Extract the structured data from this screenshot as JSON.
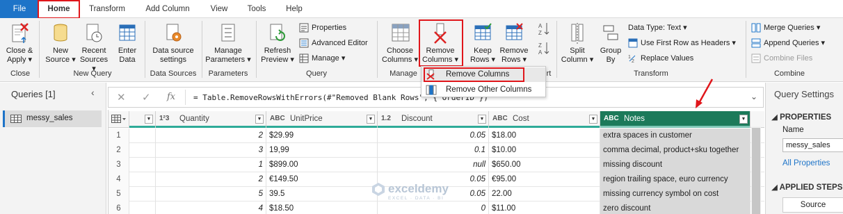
{
  "tabs": [
    "File",
    "Home",
    "Transform",
    "Add Column",
    "View",
    "Tools",
    "Help"
  ],
  "ribbon": {
    "close_apply": "Close &",
    "close_apply2": "Apply",
    "new_source": "New",
    "new_source2": "Source",
    "recent_sources": "Recent",
    "recent_sources2": "Sources",
    "enter_data": "Enter",
    "enter_data2": "Data",
    "data_source_settings": "Data source",
    "data_source_settings2": "settings",
    "manage_parameters": "Manage",
    "manage_parameters2": "Parameters",
    "refresh_preview": "Refresh",
    "refresh_preview2": "Preview",
    "properties": "Properties",
    "advanced_editor": "Advanced Editor",
    "manage": "Manage",
    "choose_columns": "Choose",
    "choose_columns2": "Columns",
    "remove_columns": "Remove",
    "remove_columns2": "Columns",
    "keep_rows": "Keep",
    "keep_rows2": "Rows",
    "remove_rows": "Remove",
    "remove_rows2": "Rows",
    "split_column": "Split",
    "split_column2": "Column",
    "group_by": "Group",
    "group_by2": "By",
    "data_type": "Data Type: Text",
    "use_first_row": "Use First Row as Headers",
    "replace_values": "Replace Values",
    "merge_queries": "Merge Queries",
    "append_queries": "Append Queries",
    "combine_files": "Combine Files",
    "groups": {
      "close": "Close",
      "new_query": "New Query",
      "data_sources": "Data Sources",
      "parameters": "Parameters",
      "query": "Query",
      "manage": "Manage",
      "transform": "Transform",
      "combine": "Combine",
      "sort_partial": "rt"
    }
  },
  "menu": {
    "remove_columns": "Remove Columns",
    "remove_other_columns": "Remove Other Columns"
  },
  "queries": {
    "title": "Queries [1]",
    "items": [
      "messy_sales"
    ]
  },
  "formula": {
    "fx": "fx",
    "text": "= Table.RemoveRowsWithErrors(#\"Removed Blank Rows\", {\"OrderID\"})"
  },
  "columns": [
    {
      "type": "",
      "name": ""
    },
    {
      "type": "1²3",
      "name": "Quantity"
    },
    {
      "type": "ABC",
      "name": "UnitPrice"
    },
    {
      "type": "1.2",
      "name": "Discount"
    },
    {
      "type": "ABC",
      "name": "Cost"
    },
    {
      "type": "ABC",
      "name": "Notes"
    }
  ],
  "rows": [
    {
      "idx": "1",
      "quantity": "2",
      "unitprice": "$29.99",
      "discount": "0.05",
      "cost": "$18.00",
      "notes": "extra spaces in customer"
    },
    {
      "idx": "2",
      "quantity": "3",
      "unitprice": "19,99",
      "discount": "0.1",
      "cost": "$10.00",
      "notes": "comma decimal, product+sku together"
    },
    {
      "idx": "3",
      "quantity": "1",
      "unitprice": "$899.00",
      "discount": "null",
      "cost": "$650.00",
      "notes": "missing discount"
    },
    {
      "idx": "4",
      "quantity": "2",
      "unitprice": "€149.50",
      "discount": "0.05",
      "cost": "€95.00",
      "notes": "region trailing space, euro currency"
    },
    {
      "idx": "5",
      "quantity": "5",
      "unitprice": "39.5",
      "discount": "0.05",
      "cost": "22.00",
      "notes": "missing currency symbol on cost"
    },
    {
      "idx": "6",
      "quantity": "4",
      "unitprice": "$18.50",
      "discount": "0",
      "cost": "$11.00",
      "notes": "zero discount"
    }
  ],
  "settings": {
    "title": "Query Settings",
    "properties": "PROPERTIES",
    "name_label": "Name",
    "name_value": "messy_sales",
    "all_properties": "All Properties",
    "applied_steps": "APPLIED STEPS",
    "step_source": "Source"
  },
  "watermark": {
    "brand": "exceldemy",
    "tagline": "EXCEL · DATA · BI"
  },
  "colors": {
    "accent": "#1e74c8",
    "highlight": "#e0161b",
    "selected_header": "#1c7a5a",
    "quality_bar": "#2eab98"
  }
}
